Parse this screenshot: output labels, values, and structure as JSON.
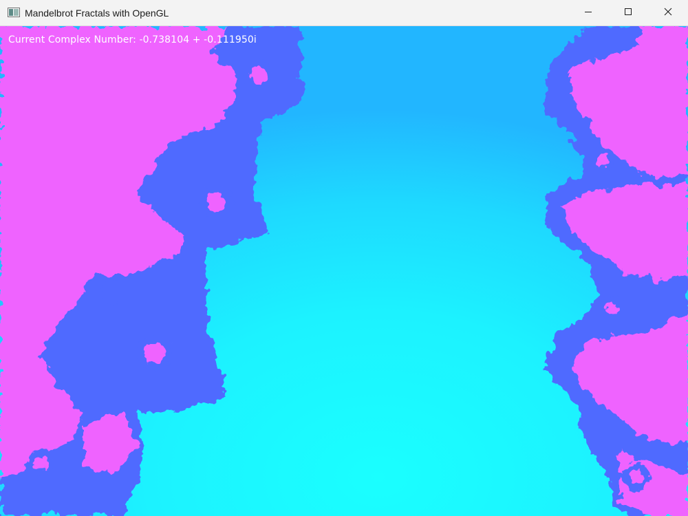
{
  "window": {
    "title": "Mandelbrot Fractals with OpenGL",
    "icon": "app-window-icon",
    "controls": {
      "minimize_icon": "minimize-icon",
      "maximize_icon": "maximize-icon",
      "close_icon": "close-icon"
    }
  },
  "canvas": {
    "label_prefix": "Current Complex Number:",
    "real": "-0.738104",
    "imag": "-0.111950i",
    "overlay_text": "Current Complex Number: -0.738104 + -0.111950i",
    "colors": {
      "interior_cyan": "#1affff",
      "edge_cyan": "#1fd0ff",
      "escape_blue": "#4f6bff",
      "escape_magenta": "#ef63ff"
    }
  }
}
